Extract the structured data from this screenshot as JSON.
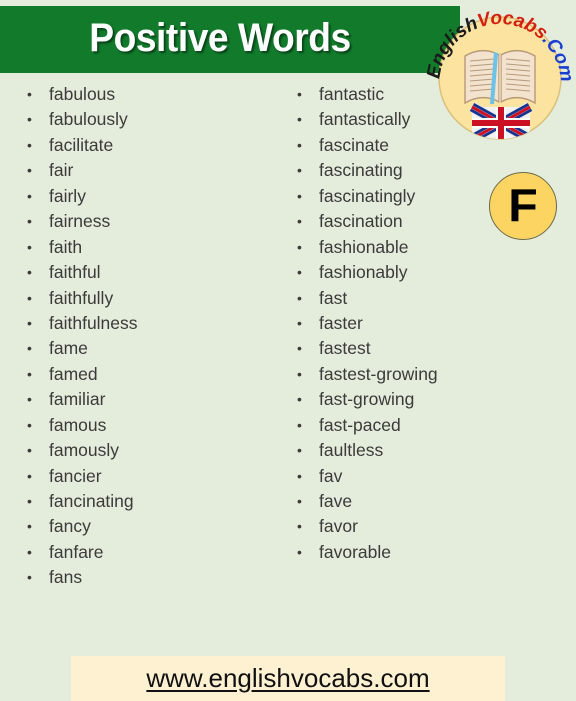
{
  "header": {
    "title": "Positive Words",
    "band_color": "#117a2b",
    "title_color": "#ffffff"
  },
  "logo": {
    "name": "englishvocabs-logo",
    "text_part_1": "English",
    "text_part_2": "Vocabs",
    "text_part_3": ".Com",
    "color_part_1": "#1a1a1a",
    "color_part_2": "#d32011",
    "color_part_3": "#1a3fd0",
    "circle_color": "#fce3a0",
    "graphics": [
      "open-book-icon",
      "uk-flag-icon"
    ]
  },
  "letter_badge": {
    "letter": "F",
    "background": "#fcd462",
    "text_color": "#000000"
  },
  "page": {
    "background": "#e4ecdb",
    "word_text_color": "#3b3b3b"
  },
  "columns": {
    "left": [
      "fabulous",
      "fabulously",
      "facilitate",
      "fair",
      "fairly",
      "fairness",
      "faith",
      "faithful",
      "faithfully",
      "faithfulness",
      "fame",
      "famed",
      "familiar",
      "famous",
      "famously",
      "fancier",
      "fancinating",
      "fancy",
      "fanfare",
      "fans"
    ],
    "right": [
      "fantastic",
      "fantastically",
      "fascinate",
      "fascinating",
      "fascinatingly",
      "fascination",
      "fashionable",
      "fashionably",
      "fast",
      "faster",
      "fastest",
      "fastest-growing",
      "fast-growing",
      "fast-paced",
      "faultless",
      "fav",
      "fave",
      "favor",
      "favorable"
    ]
  },
  "footer": {
    "url": "www.englishvocabs.com",
    "background": "#fdf1d2",
    "text_color": "#111111"
  }
}
